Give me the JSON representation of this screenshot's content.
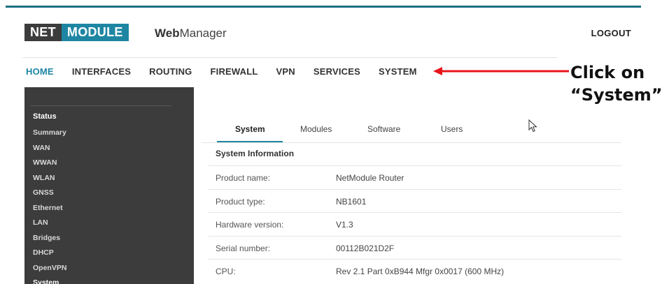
{
  "header": {
    "logo_net": "NET",
    "logo_module": "MODULE",
    "brand_bold": "Web",
    "brand_light": "Manager",
    "logout": "LOGOUT"
  },
  "nav": {
    "items": [
      "HOME",
      "INTERFACES",
      "ROUTING",
      "FIREWALL",
      "VPN",
      "SERVICES",
      "SYSTEM"
    ],
    "active": "HOME"
  },
  "annotation": {
    "line1": "Click on",
    "line2": "“System”",
    "arrow_color": "#e8141c"
  },
  "sidebar": {
    "heading": "Status",
    "items": [
      "Summary",
      "WAN",
      "WWAN",
      "WLAN",
      "GNSS",
      "Ethernet",
      "LAN",
      "Bridges",
      "DHCP",
      "OpenVPN",
      "System"
    ],
    "active": "System"
  },
  "tabs": {
    "items": [
      "System",
      "Modules",
      "Software",
      "Users"
    ],
    "active": "System"
  },
  "section": {
    "title": "System Information"
  },
  "info": {
    "rows": [
      {
        "label": "Product name:",
        "value": "NetModule Router"
      },
      {
        "label": "Product type:",
        "value": "NB1601"
      },
      {
        "label": "Hardware version:",
        "value": "V1.3"
      },
      {
        "label": "Serial number:",
        "value": "00112B021D2F"
      },
      {
        "label": "CPU:",
        "value": "Rev 2.1 Part 0xB944 Mfgr 0x0017 (600 MHz)"
      }
    ]
  },
  "colors": {
    "accent": "#1e86a3",
    "sidebar_bg": "#3c3c3c",
    "top_rule": "#1b6f82"
  },
  "icons": {
    "pointer": "mouse-pointer-icon"
  }
}
